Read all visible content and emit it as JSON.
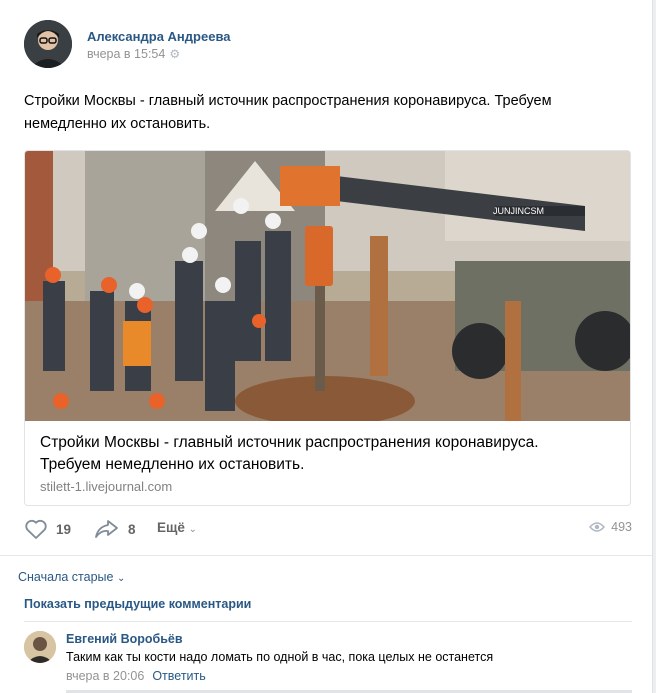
{
  "post": {
    "author": "Александра Андреева",
    "time": "вчера в 15:54",
    "text": "Стройки Москвы - главный источник распространения коронавируса. Требуем немедленно их остановить.",
    "attachment": {
      "title": "Стройки Москвы - главный источник распространения коронавируса. Требуем немедленно их остановить.",
      "domain": "stilett-1.livejournal.com",
      "image_label": "JUNJINCSM"
    },
    "likes": "19",
    "shares": "8",
    "more_label": "Ещё",
    "views": "493"
  },
  "comments": {
    "sort_label": "Сначала старые",
    "show_previous": "Показать предыдущие комментарии",
    "items": [
      {
        "author": "Евгений Воробьёв",
        "text": "Таким как ты кости надо ломать по одной в час, пока целых не останется",
        "time": "вчера в 20:06",
        "reply_label": "Ответить"
      }
    ]
  },
  "icons": [
    "gear-icon",
    "heart-icon",
    "share-icon",
    "chevron-down-icon",
    "eye-icon"
  ],
  "colors": {
    "link": "#2a5885",
    "muted": "#939393",
    "icon": "#818c99",
    "page_bg": "#edeef0"
  }
}
